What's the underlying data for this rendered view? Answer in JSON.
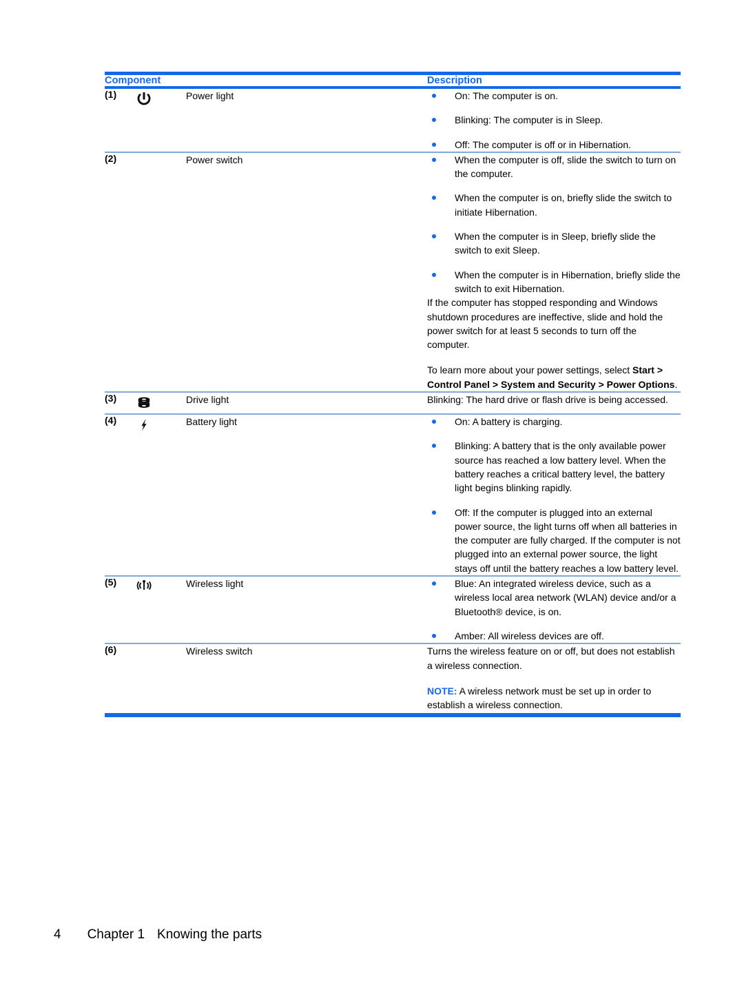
{
  "table": {
    "headers": {
      "component": "Component",
      "description": "Description"
    },
    "accent_color": "#1569E8",
    "rule_color": "#7FA9D6",
    "rows": [
      {
        "number": "(1)",
        "icon": "power-icon",
        "name": "Power light",
        "bullets": [
          "On: The computer is on.",
          "Blinking: The computer is in Sleep.",
          "Off: The computer is off or in Hibernation."
        ]
      },
      {
        "number": "(2)",
        "icon": "none",
        "name": "Power switch",
        "bullets": [
          "When the computer is off, slide the switch to turn on the computer.",
          "When the computer is on, briefly slide the switch to initiate Hibernation.",
          "When the computer is in Sleep, briefly slide the switch to exit Sleep.",
          "When the computer is in Hibernation, briefly slide the switch to exit Hibernation."
        ],
        "paragraph1": "If the computer has stopped responding and Windows shutdown procedures are ineffective, slide and hold the power switch for at least 5 seconds to turn off the computer.",
        "paragraph2_prefix": "To learn more about your power settings, select ",
        "paragraph2_bold": "Start > Control Panel > System and Security > Power Options",
        "paragraph2_suffix": "."
      },
      {
        "number": "(3)",
        "icon": "drive-icon",
        "name": "Drive light",
        "paragraph1": "Blinking: The hard drive or flash drive is being accessed."
      },
      {
        "number": "(4)",
        "icon": "battery-bolt-icon",
        "name": "Battery light",
        "bullets": [
          "On: A battery is charging.",
          "Blinking: A battery that is the only available power source has reached a low battery level. When the battery reaches a critical battery level, the battery light begins blinking rapidly.",
          "Off: If the computer is plugged into an external power source, the light turns off when all batteries in the computer are fully charged. If the computer is not plugged into an external power source, the light stays off until the battery reaches a low battery level."
        ]
      },
      {
        "number": "(5)",
        "icon": "wireless-icon",
        "name": "Wireless light",
        "bullets": [
          "Blue: An integrated wireless device, such as a wireless local area network (WLAN) device and/or a Bluetooth® device, is on.",
          "Amber: All wireless devices are off."
        ]
      },
      {
        "number": "(6)",
        "icon": "none",
        "name": "Wireless switch",
        "paragraph1": "Turns the wireless feature on or off, but does not establish a wireless connection.",
        "note_label": "NOTE:",
        "note_text": " A wireless network must be set up in order to establish a wireless connection."
      }
    ]
  },
  "footer": {
    "page_number": "4",
    "chapter": "Chapter 1",
    "chapter_title": "Knowing the parts"
  }
}
